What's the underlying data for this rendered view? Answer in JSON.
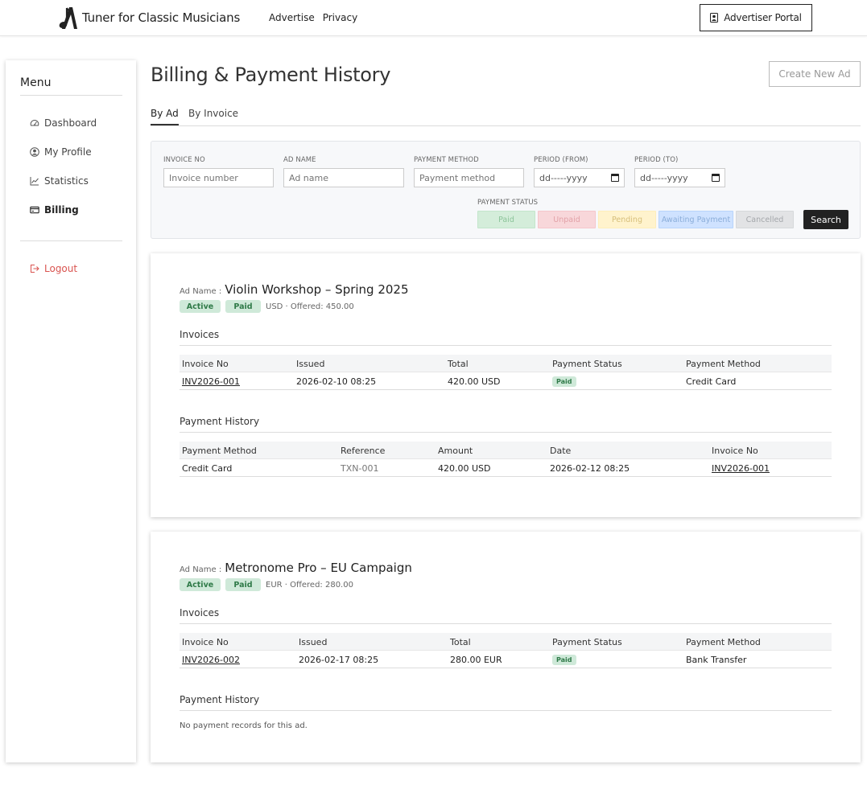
{
  "header": {
    "app_title": "Tuner for Classic Musicians",
    "nav": [
      "Advertise",
      "Privacy"
    ],
    "portal_button": "Advertiser Portal"
  },
  "sidebar": {
    "title": "Menu",
    "items": [
      {
        "label": "Dashboard",
        "icon": "gauge-icon"
      },
      {
        "label": "My Profile",
        "icon": "user-circle-icon"
      },
      {
        "label": "Statistics",
        "icon": "chart-line-icon"
      },
      {
        "label": "Billing",
        "icon": "credit-card-icon",
        "active": true
      }
    ],
    "logout": "Logout"
  },
  "main": {
    "title": "Billing & Payment History",
    "create_button": "Create New Ad",
    "tabs": [
      {
        "label": "By Ad",
        "active": true
      },
      {
        "label": "By Invoice",
        "active": false
      }
    ]
  },
  "filters": {
    "invoice_no": {
      "label": "INVOICE NO",
      "placeholder": "Invoice number"
    },
    "ad_name": {
      "label": "AD NAME",
      "placeholder": "Ad name"
    },
    "payment_method": {
      "label": "PAYMENT METHOD",
      "placeholder": "Payment method"
    },
    "period_from": {
      "label": "PERIOD (FROM)",
      "value": "dd-----yyyy"
    },
    "period_to": {
      "label": "PERIOD (TO)",
      "value": "dd-----yyyy"
    },
    "payment_status": {
      "label": "PAYMENT STATUS",
      "options": [
        "Paid",
        "Unpaid",
        "Pending",
        "Awaiting Payment",
        "Cancelled"
      ]
    },
    "search_button": "Search"
  },
  "ads": [
    {
      "name_label": "Ad Name :",
      "name": "Violin Workshop – Spring 2025",
      "badges": [
        "Active",
        "Paid"
      ],
      "offered": "USD · Offered: 450.00",
      "invoices_title": "Invoices",
      "invoice_headers": [
        "Invoice No",
        "Issued",
        "Total",
        "Payment Status",
        "Payment Method"
      ],
      "invoices": [
        {
          "no": "INV2026-001",
          "issued": "2026-02-10 08:25",
          "total": "420.00 USD",
          "status": "Paid",
          "method": "Credit Card"
        }
      ],
      "history_title": "Payment History",
      "history_headers": [
        "Payment Method",
        "Reference",
        "Amount",
        "Date",
        "Invoice No"
      ],
      "history": [
        {
          "method": "Credit Card",
          "reference": "TXN-001",
          "amount": "420.00 USD",
          "date": "2026-02-12 08:25",
          "invoice": "INV2026-001"
        }
      ]
    },
    {
      "name_label": "Ad Name :",
      "name": "Metronome Pro – EU Campaign",
      "badges": [
        "Active",
        "Paid"
      ],
      "offered": "EUR · Offered: 280.00",
      "invoices_title": "Invoices",
      "invoice_headers": [
        "Invoice No",
        "Issued",
        "Total",
        "Payment Status",
        "Payment Method"
      ],
      "invoices": [
        {
          "no": "INV2026-002",
          "issued": "2026-02-17 08:25",
          "total": "280.00 EUR",
          "status": "Paid",
          "method": "Bank Transfer"
        }
      ],
      "history_title": "Payment History",
      "history_empty": "No payment records for this ad."
    }
  ]
}
